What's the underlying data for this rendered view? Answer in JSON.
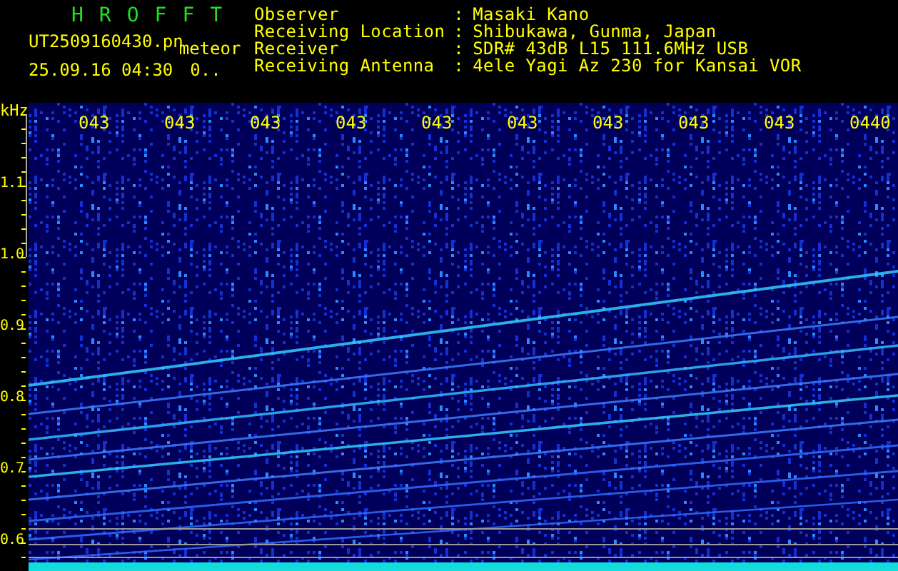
{
  "header": {
    "title": "HROFFT",
    "file_name": "UT2509160430.pn",
    "mode": "meteor",
    "timestamp": "25.09.16 04:30",
    "counter": "0.."
  },
  "info": [
    {
      "label": "Observer",
      "separator": ":",
      "value": "Masaki Kano"
    },
    {
      "label": "Receiving Location",
      "separator": ":",
      "value": "Shibukawa, Gunma, Japan"
    },
    {
      "label": "Receiver",
      "separator": ":",
      "value": "SDR# 43dB L15 111.6MHz USB"
    },
    {
      "label": "Receiving Antenna",
      "separator": ":",
      "value": "4ele Yagi Az 230 for Kansai VOR"
    }
  ],
  "frequency_axis": {
    "unit": "kHz",
    "ticks": [
      "1.1",
      "1.0",
      "0.9",
      "0.8",
      "0.7",
      "0.6"
    ]
  },
  "time_labels": [
    "043",
    "043",
    "043",
    "043",
    "043",
    "043",
    "043",
    "043",
    "043",
    "0440"
  ]
}
